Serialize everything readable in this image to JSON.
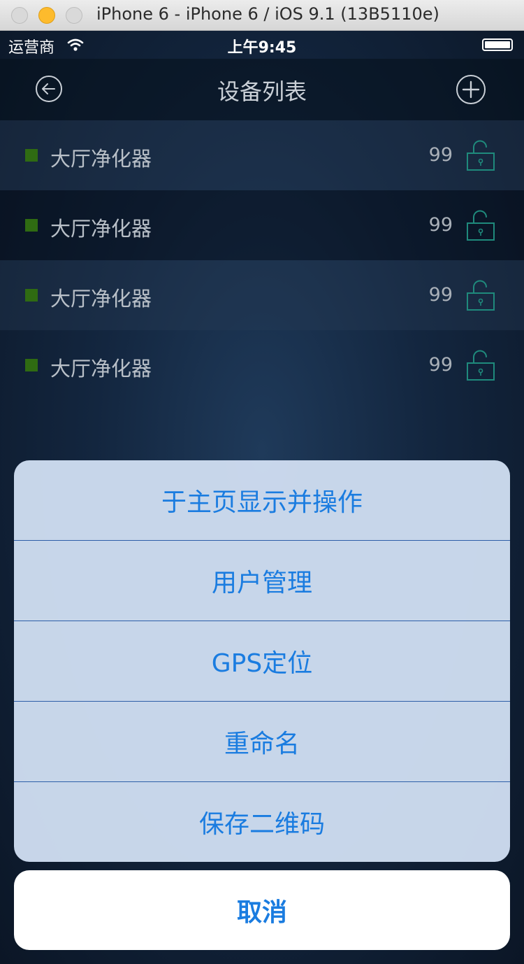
{
  "window": {
    "title": "iPhone 6 - iPhone 6 / iOS 9.1 (13B5110e)"
  },
  "status_bar": {
    "carrier": "运营商",
    "time": "上午9:45"
  },
  "nav": {
    "title": "设备列表",
    "back_icon": "back-arrow-circle-icon",
    "add_icon": "plus-circle-icon"
  },
  "devices": [
    {
      "name": "大厅净化器",
      "count": "99",
      "status_color": "#2f6b12",
      "lock_icon": "unlock-icon"
    },
    {
      "name": "大厅净化器",
      "count": "99",
      "status_color": "#2f6b12",
      "lock_icon": "unlock-icon"
    },
    {
      "name": "大厅净化器",
      "count": "99",
      "status_color": "#2f6b12",
      "lock_icon": "unlock-icon"
    },
    {
      "name": "大厅净化器",
      "count": "99",
      "status_color": "#2f6b12",
      "lock_icon": "unlock-icon"
    }
  ],
  "action_sheet": {
    "items": [
      {
        "label": "于主页显示并操作"
      },
      {
        "label": "用户管理"
      },
      {
        "label": "GPS定位"
      },
      {
        "label": "重命名"
      },
      {
        "label": "保存二维码"
      }
    ],
    "cancel_label": "取消",
    "accent_color": "#1a7ce0"
  }
}
